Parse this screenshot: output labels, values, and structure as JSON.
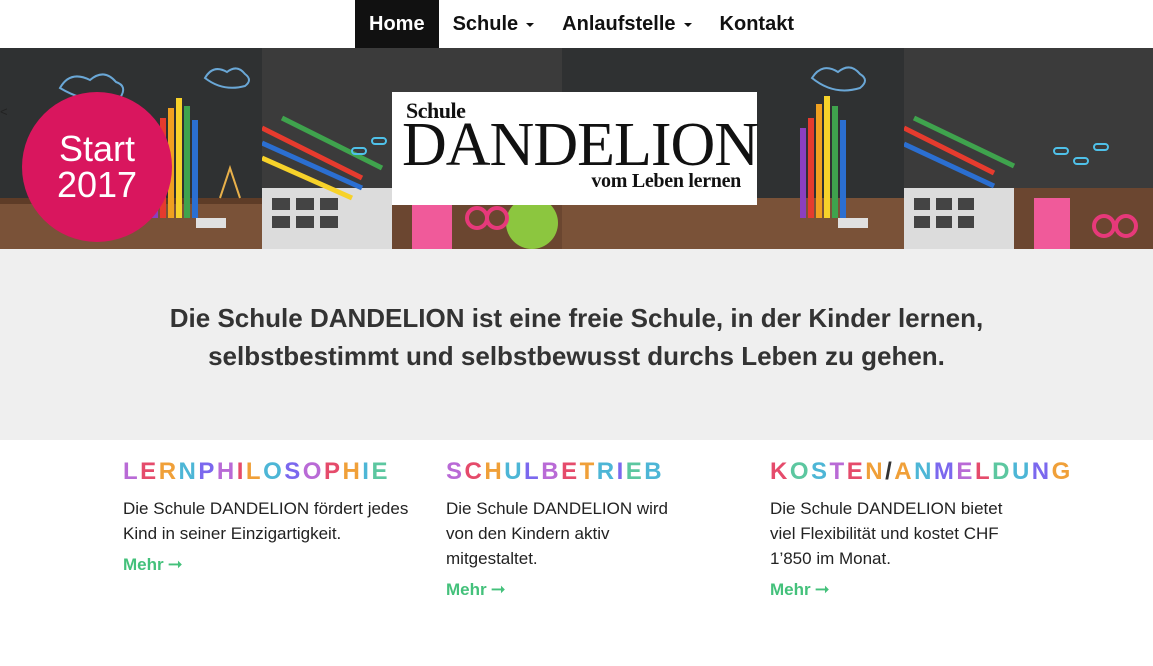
{
  "nav": {
    "items": [
      {
        "label": "Home",
        "active": true,
        "dropdown": false
      },
      {
        "label": "Schule",
        "active": false,
        "dropdown": true
      },
      {
        "label": "Anlaufstelle",
        "active": false,
        "dropdown": true
      },
      {
        "label": "Kontakt",
        "active": false,
        "dropdown": false
      }
    ]
  },
  "hero": {
    "prev_arrow": "<",
    "badge": {
      "line1": "Start",
      "line2": "2017",
      "color": "#d9165e"
    },
    "logo": {
      "small": "Schule",
      "big": "DANDELION",
      "sub": "vom Leben lernen"
    }
  },
  "intro": {
    "text": "Die Schule DANDELION ist eine freie Schule, in der Kinder lernen, selbstbestimmt und selbstbewusst durchs Leben zu gehen."
  },
  "columns": [
    {
      "title": "LERNPHILOSOPHIE",
      "title_colors": [
        "#b96ad6",
        "#e54b6b",
        "#f0a039",
        "#4db6d6",
        "#7b68ee",
        "#b96ad6",
        "#e54b6b",
        "#f0a039",
        "#4db6d6",
        "#7b68ee",
        "#b96ad6",
        "#e54b6b",
        "#f0a039",
        "#4db6d6",
        "#5cc7a0"
      ],
      "description": "Die Schule DANDELION fördert jedes Kind in seiner Einzigartigkeit.",
      "more_label": "Mehr",
      "more_icon": "arrow-right-icon"
    },
    {
      "title": "SCHULBETRIEB",
      "title_colors": [
        "#b96ad6",
        "#e54b6b",
        "#f0a039",
        "#4db6d6",
        "#7b68ee",
        "#b96ad6",
        "#e54b6b",
        "#f0a039",
        "#4db6d6",
        "#7b68ee",
        "#5cc7a0",
        "#4db6d6"
      ],
      "description": "Die Schule DANDELION wird von den Kindern aktiv mitgestaltet.",
      "more_label": "Mehr",
      "more_icon": "arrow-right-icon"
    },
    {
      "title": "KOSTEN/ANMELDUNG",
      "title_colors": [
        "#e54b6b",
        "#5cc7a0",
        "#4db6d6",
        "#b96ad6",
        "#e54b6b",
        "#f0a039",
        "#333333",
        "#f0a039",
        "#4db6d6",
        "#7b68ee",
        "#b96ad6",
        "#e54b6b",
        "#5cc7a0",
        "#4db6d6",
        "#7b68ee",
        "#f0a039"
      ],
      "description": "Die Schule DANDELION bietet viel Flexibilität und kostet CHF 1’850 im Monat.",
      "more_label": "Mehr",
      "more_icon": "arrow-right-icon"
    }
  ],
  "colors": {
    "accent_green": "#44c17b",
    "nav_active_bg": "#111111",
    "intro_bg": "#efefef"
  }
}
